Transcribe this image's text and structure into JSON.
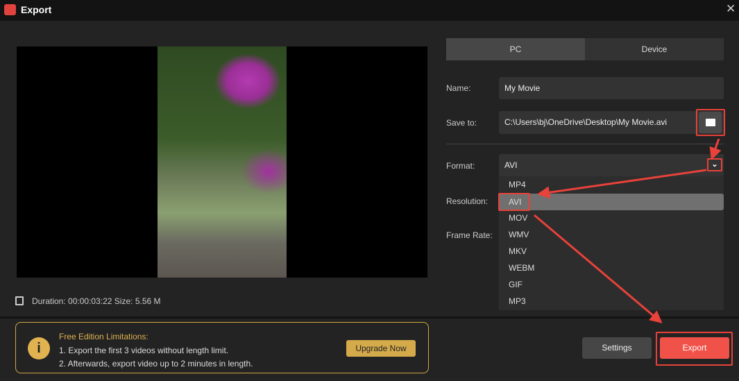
{
  "window": {
    "title": "Export",
    "close_icon": "close-icon"
  },
  "preview": {
    "duration_label": "Duration:",
    "duration": "00:00:03:22",
    "size_label": "Size:",
    "size": "5.56 M"
  },
  "tabs": [
    {
      "label": "PC",
      "selected": true
    },
    {
      "label": "Device",
      "selected": false
    }
  ],
  "form": {
    "name_label": "Name:",
    "name_value": "My Movie",
    "save_label": "Save to:",
    "save_value": "C:\\Users\\bj\\OneDrive\\Desktop\\My Movie.avi",
    "format_label": "Format:",
    "format_value": "AVI",
    "resolution_label": "Resolution:",
    "frame_rate_label": "Frame Rate:"
  },
  "format_options": [
    "MP4",
    "AVI",
    "MOV",
    "WMV",
    "MKV",
    "WEBM",
    "GIF",
    "MP3"
  ],
  "selected_format": "AVI",
  "notice": {
    "title": "Free Edition Limitations:",
    "line1": "1. Export the first 3 videos without length limit.",
    "line2": "2. Afterwards, export video up to 2 minutes in length.",
    "upgrade": "Upgrade Now"
  },
  "buttons": {
    "settings": "Settings",
    "export": "Export"
  },
  "colors": {
    "accent": "#f0524a",
    "notice": "#d4a843"
  }
}
